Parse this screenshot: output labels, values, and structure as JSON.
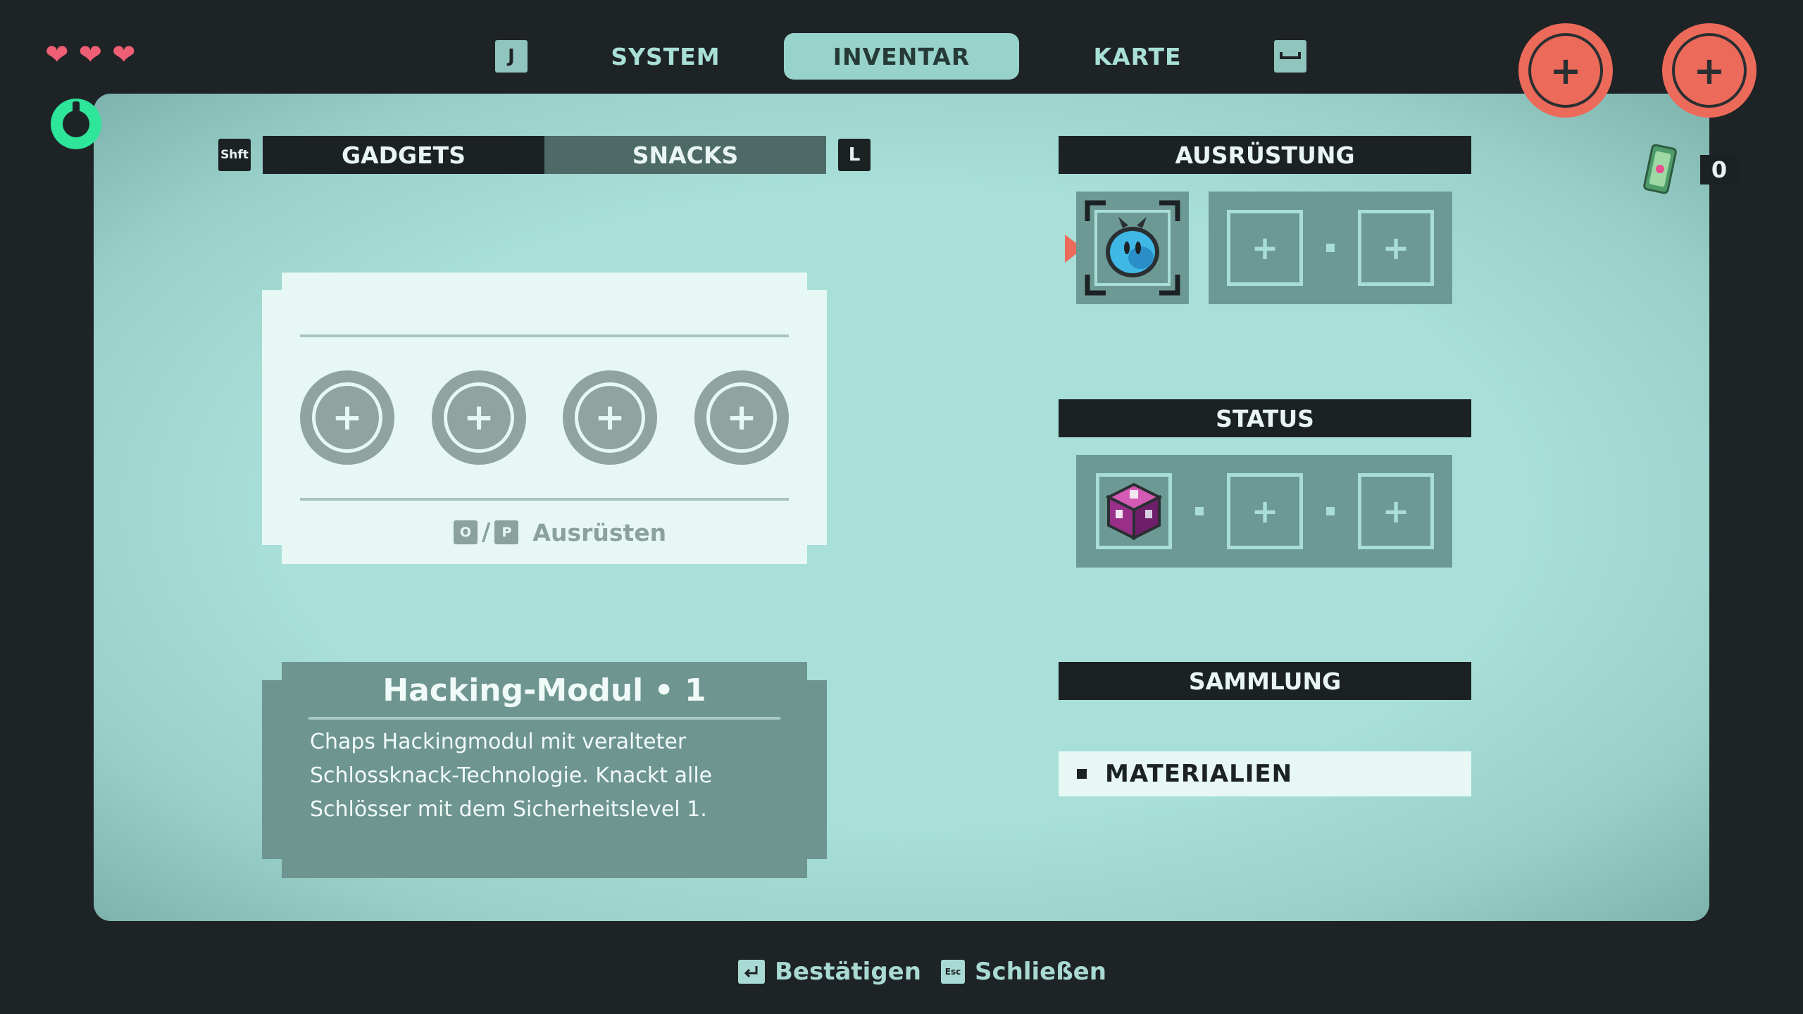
{
  "hud": {
    "hearts": [
      "heart-icon",
      "heart-icon",
      "heart-icon"
    ],
    "currency_count": "0"
  },
  "nav": {
    "left_key": "J",
    "tabs": [
      {
        "label": "SYSTEM",
        "active": false
      },
      {
        "label": "INVENTAR",
        "active": true
      },
      {
        "label": "KARTE",
        "active": false
      }
    ],
    "right_key_icon": "space-key-icon"
  },
  "gadgets_panel": {
    "prev_key": "Shft",
    "tabs": [
      "GADGETS",
      "SNACKS"
    ],
    "next_key": "L",
    "equip_hint": {
      "key1": "O",
      "key2": "P",
      "label": "Ausrüsten"
    }
  },
  "description": {
    "title": "Hacking-Modul • 1",
    "text_lines": [
      "Chaps Hackingmodul mit veralteter",
      "Schlossknack-Technologie. Knackt alle",
      "Schlösser mit dem Sicherheitslevel 1."
    ]
  },
  "equipment": {
    "header": "AUSRÜSTUNG"
  },
  "status": {
    "header": "STATUS"
  },
  "collection": {
    "header": "SAMMLUNG",
    "items": [
      "MATERIALIEN"
    ]
  },
  "footer": {
    "confirm_key": "enter-key-icon",
    "confirm_label": "Bestätigen",
    "close_key": "Esc",
    "close_label": "Schließen"
  },
  "colors": {
    "panel": "#a8e0d9",
    "accent_red": "#ec6a5a",
    "heart": "#ef5e74",
    "ring": "#2ee59a",
    "dark": "#1c2224"
  }
}
